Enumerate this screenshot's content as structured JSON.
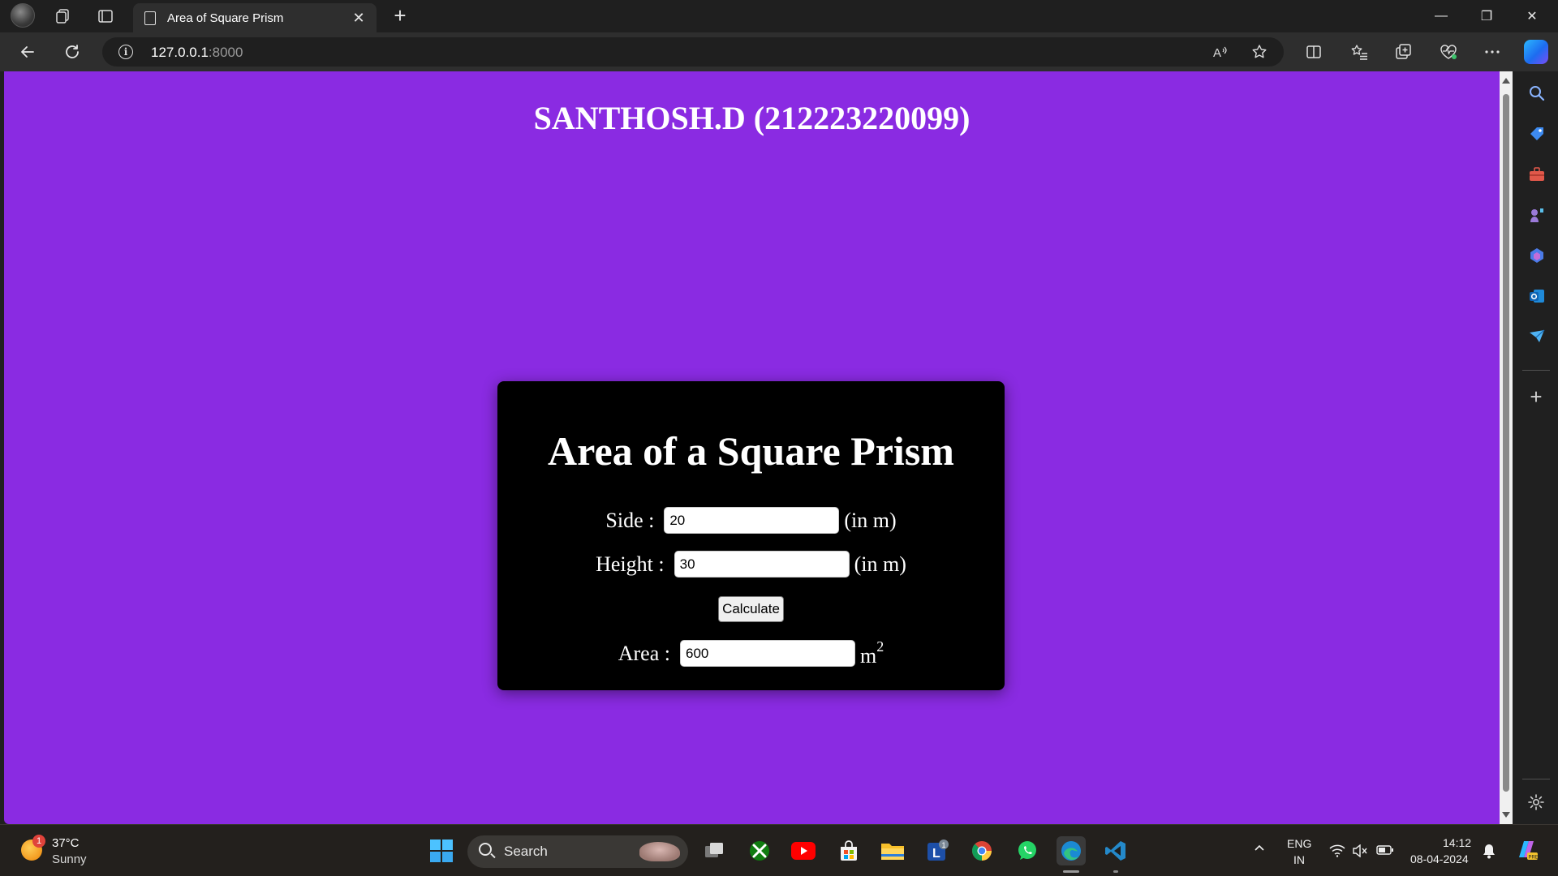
{
  "browser": {
    "tab_title": "Area of Square Prism",
    "close_glyph": "✕",
    "newtab_glyph": "+",
    "url_host": "127.0.0.1",
    "url_port": ":8000",
    "window_controls": {
      "minimize": "—",
      "restore": "❐",
      "close": "✕"
    }
  },
  "page": {
    "background_color": "#8a2be2",
    "heading": "SANTHOSH.D (212223220099)",
    "card": {
      "title": "Area of a Square Prism",
      "side_label": "Side :",
      "side_value": "20",
      "side_unit": "(in m)",
      "height_label": "Height :",
      "height_value": "30",
      "height_unit": "(in m)",
      "calculate_label": "Calculate",
      "area_label": "Area :",
      "area_value": "600",
      "area_unit": "m",
      "area_unit_exponent": "2"
    }
  },
  "taskbar": {
    "weather_temp": "37°C",
    "weather_condition": "Sunny",
    "weather_badge": "1",
    "search_placeholder": "Search",
    "lens_badge": "1",
    "language_top": "ENG",
    "language_bottom": "IN",
    "time": "14:12",
    "date": "08-04-2024",
    "chevron": "^"
  }
}
